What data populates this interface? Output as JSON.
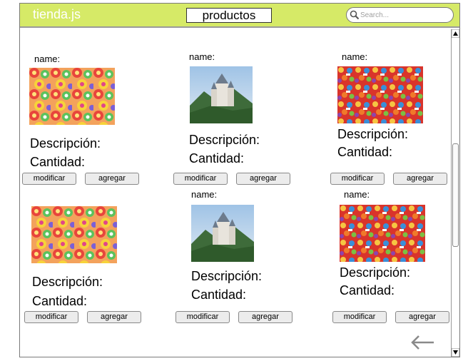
{
  "app": {
    "brand": "tienda.js",
    "page_title": "productos"
  },
  "search": {
    "placeholder": "Search..."
  },
  "products": [
    {
      "name_label": "name:",
      "image": "candy-lollipops",
      "description_label": "Descripción:",
      "quantity_label": "Cantidad:",
      "modify_label": "modificar",
      "add_label": "agregar"
    },
    {
      "name_label": "name:",
      "image": "castle-landscape",
      "description_label": "Descripción:",
      "quantity_label": "Cantidad:",
      "modify_label": "modificar",
      "add_label": "agregar"
    },
    {
      "name_label": "name:",
      "image": "candy-mix",
      "description_label": "Descripción:",
      "quantity_label": "Cantidad:",
      "modify_label": "modificar",
      "add_label": "agregar"
    },
    {
      "name_label": "",
      "image": "candy-lollipops",
      "description_label": "Descripción:",
      "quantity_label": "Cantidad:",
      "modify_label": "modificar",
      "add_label": "agregar"
    },
    {
      "name_label": "name:",
      "image": "castle-landscape",
      "description_label": "Descripción:",
      "quantity_label": "Cantidad:",
      "modify_label": "modificar",
      "add_label": "agregar"
    },
    {
      "name_label": "name:",
      "image": "candy-mix",
      "description_label": "Descripción:",
      "quantity_label": "Cantidad:",
      "modify_label": "modificar",
      "add_label": "agregar"
    }
  ],
  "icons": {
    "search": "search-icon",
    "back": "arrow-left-icon"
  },
  "colors": {
    "header": "#d6ea67",
    "brand_text": "#ffffff"
  }
}
